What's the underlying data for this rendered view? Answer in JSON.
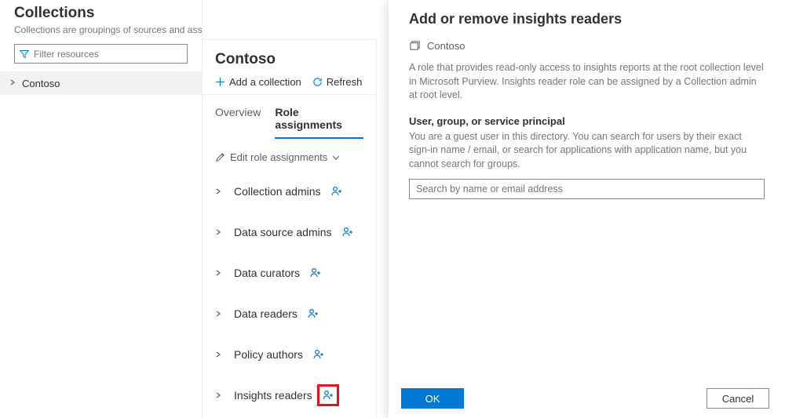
{
  "sidebar": {
    "title": "Collections",
    "subtitle": "Collections are groupings of sources and assets. With a collection, you can take action on all of its content",
    "filter_placeholder": "Filter resources",
    "tree": {
      "root": "Contoso"
    }
  },
  "mid": {
    "title": "Contoso",
    "actions": {
      "add": "Add a collection",
      "refresh": "Refresh"
    },
    "tabs": {
      "overview": "Overview",
      "role_assignments": "Role assignments"
    },
    "edit_label": "Edit role assignments",
    "roles": [
      {
        "name": "Collection admins"
      },
      {
        "name": "Data source admins"
      },
      {
        "name": "Data curators"
      },
      {
        "name": "Data readers"
      },
      {
        "name": "Policy authors"
      },
      {
        "name": "Insights readers",
        "highlight": true
      }
    ]
  },
  "panel": {
    "title": "Add or remove insights readers",
    "org": "Contoso",
    "description": "A role that provides read-only access to insights reports at the root collection level in Microsoft Purview. Insights reader role can be assigned by a Collection admin at root level.",
    "section_label": "User, group, or service principal",
    "section_help": "You are a guest user in this directory. You can search for users by their exact sign-in name / email, or search for applications with application name, but you cannot search for groups.",
    "search_placeholder": "Search by name or email address",
    "ok": "OK",
    "cancel": "Cancel"
  }
}
